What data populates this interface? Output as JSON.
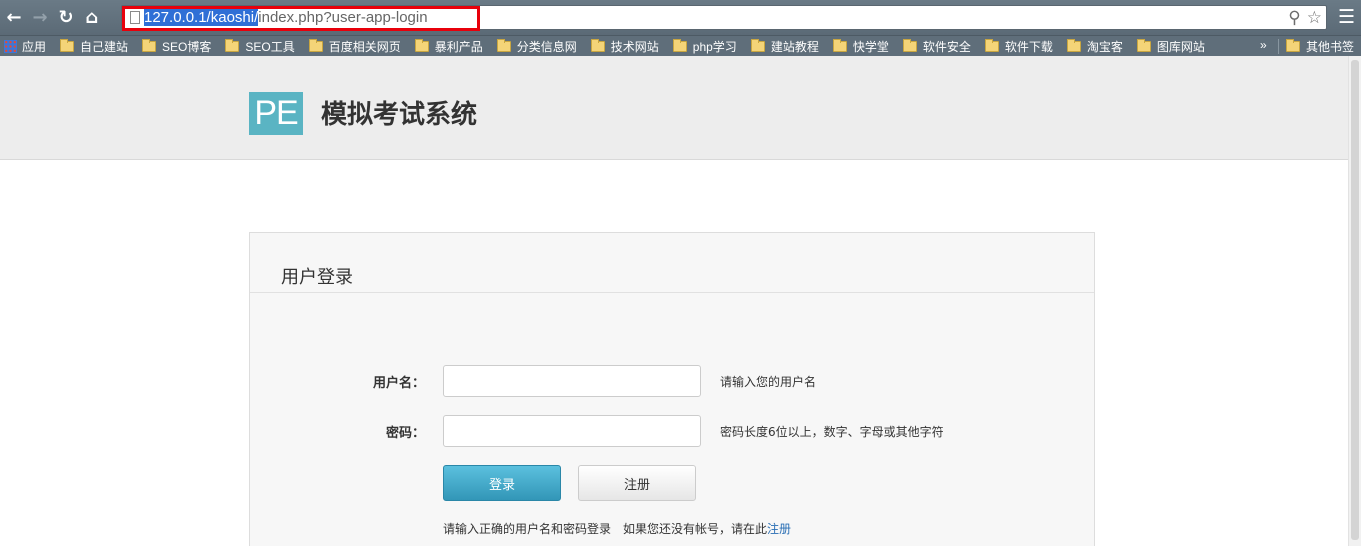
{
  "browser": {
    "url_selected": "127.0.0.1/kaoshi/",
    "url_rest": "index.php?user-app-login",
    "bookmarks_apps_label": "应用",
    "bookmarks": [
      "自己建站",
      "SEO博客",
      "SEO工具",
      "百度相关网页",
      "暴利产品",
      "分类信息网",
      "技术网站",
      "php学习",
      "建站教程",
      "快学堂",
      "软件安全",
      "软件下载",
      "淘宝客",
      "图库网站"
    ],
    "bookmarks_overflow": "»",
    "other_bookmarks": "其他书签"
  },
  "site": {
    "logo_text": "PE",
    "title": "模拟考试系统"
  },
  "login": {
    "panel_title": "用户登录",
    "username_label": "用户名：",
    "username_hint": "请输入您的用户名",
    "password_label": "密码：",
    "password_hint": "密码长度6位以上，数字、字母或其他字符",
    "login_button": "登录",
    "register_button": "注册",
    "footer_text": "请输入正确的用户名和密码登录　如果您还没有帐号，请在此",
    "footer_link": "注册"
  },
  "colors": {
    "url_highlight": "#e8000b",
    "primary_button": "#3296b7",
    "logo_bg": "#5ab4c3"
  }
}
